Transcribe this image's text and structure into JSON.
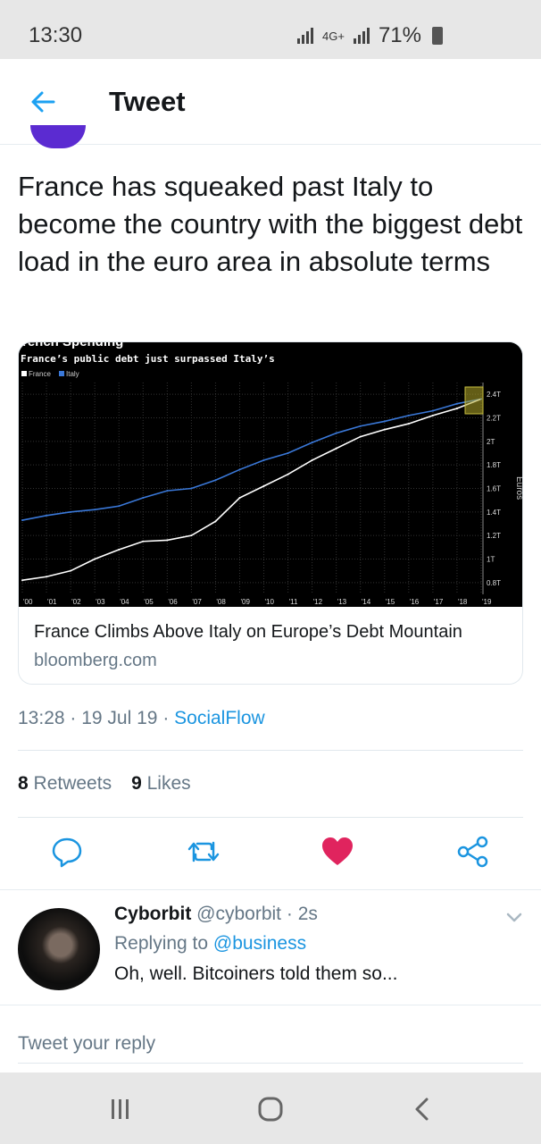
{
  "status_bar": {
    "time": "13:30",
    "network": "4G+",
    "battery": "71%"
  },
  "header": {
    "title": "Tweet"
  },
  "tweet": {
    "text": "France has squeaked past Italy to become the country with the biggest debt load in the euro area in absolute terms",
    "card": {
      "title": "France Climbs Above Italy on Europe’s Debt Mountain",
      "domain": "bloomberg.com"
    },
    "time": "13:28",
    "date": "19 Jul 19",
    "source": "SocialFlow",
    "retweets_count": "8",
    "retweets_label": "Retweets",
    "likes_count": "9",
    "likes_label": "Likes"
  },
  "chart_data": {
    "type": "line",
    "title": "rench Spending",
    "subtitle": "France’s public debt just surpassed Italy’s",
    "legend_position": "top-left",
    "ylabel": "Euros",
    "ylim": [
      0.7,
      2.5
    ],
    "x_tick_labels": [
      "'00",
      "'01",
      "'02",
      "'03",
      "'04",
      "'05",
      "'06",
      "'07",
      "'08",
      "'09",
      "'10",
      "'11",
      "'12",
      "'13",
      "'14",
      "'15",
      "'16",
      "'17",
      "'18",
      "'19"
    ],
    "y_ticks": [
      0.8,
      1.0,
      1.2,
      1.4,
      1.6,
      1.8,
      2.0,
      2.2,
      2.4
    ],
    "y_tick_labels": [
      "0.8T",
      "1T",
      "1.2T",
      "1.4T",
      "1.6T",
      "1.8T",
      "2T",
      "2.2T",
      "2.4T"
    ],
    "x": [
      2000,
      2001,
      2002,
      2003,
      2004,
      2005,
      2006,
      2007,
      2008,
      2009,
      2010,
      2011,
      2012,
      2013,
      2014,
      2015,
      2016,
      2017,
      2018,
      2019
    ],
    "series": [
      {
        "name": "France",
        "color": "#ffffff",
        "values": [
          0.82,
          0.85,
          0.9,
          1.0,
          1.08,
          1.15,
          1.16,
          1.2,
          1.32,
          1.52,
          1.62,
          1.72,
          1.84,
          1.94,
          2.04,
          2.1,
          2.15,
          2.22,
          2.28,
          2.36
        ]
      },
      {
        "name": "Italy",
        "color": "#3a78d8",
        "values": [
          1.33,
          1.37,
          1.4,
          1.42,
          1.45,
          1.52,
          1.58,
          1.6,
          1.67,
          1.76,
          1.84,
          1.9,
          1.99,
          2.07,
          2.13,
          2.17,
          2.22,
          2.26,
          2.32,
          2.36
        ]
      }
    ]
  },
  "reply": {
    "name": "Cyborbit",
    "handle": "@cyborbit",
    "time": "· 2s",
    "replying_prefix": "Replying to",
    "replying_to": "@business",
    "text": "Oh, well. Bitcoiners told them so..."
  },
  "compose": {
    "placeholder": "Tweet your reply"
  },
  "colors": {
    "accent": "#1b95e0",
    "like": "#e0245e",
    "status_bg": "#e7e7e7"
  }
}
